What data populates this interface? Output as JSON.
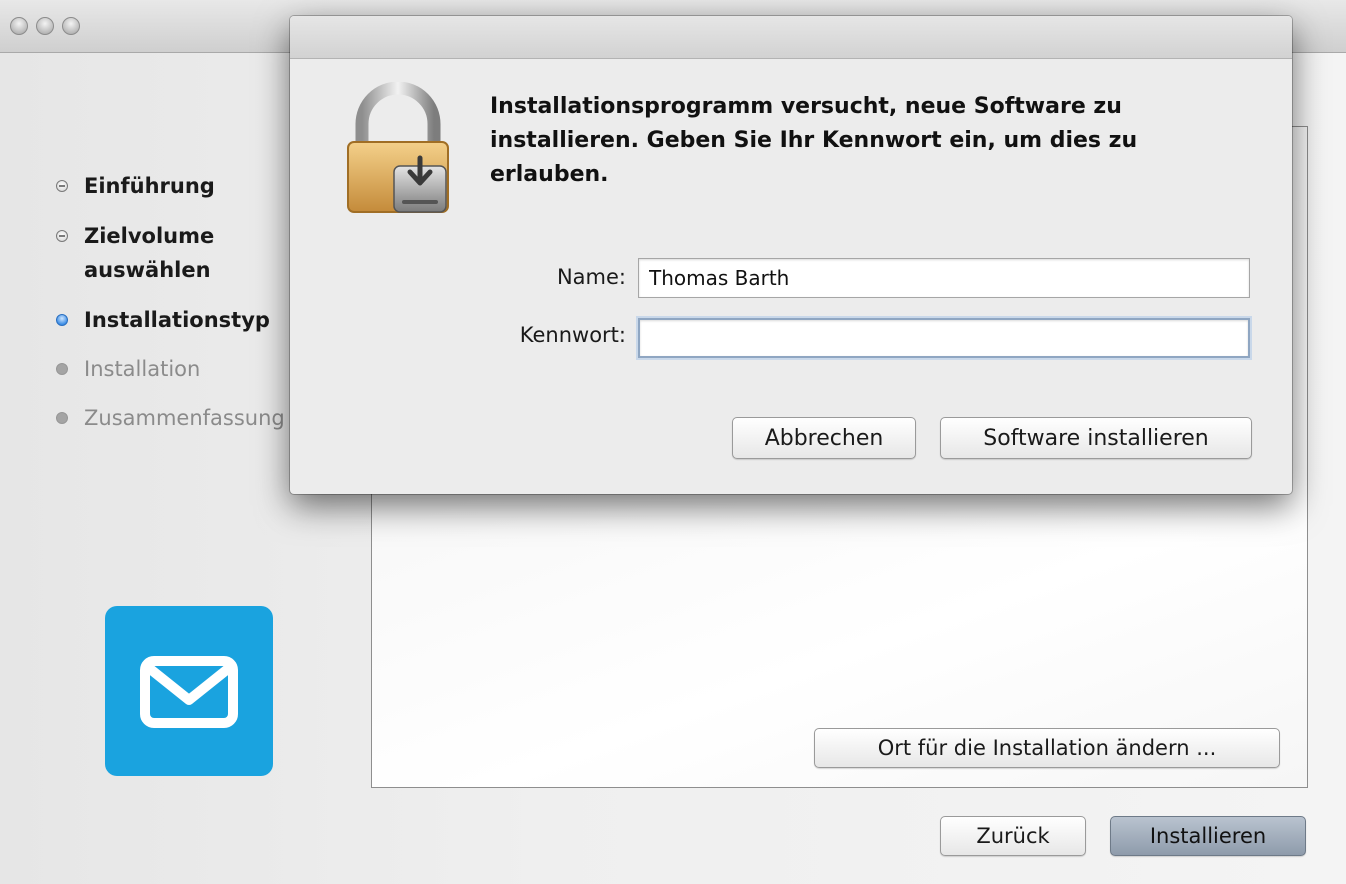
{
  "installer": {
    "steps": [
      {
        "label": "Einführung",
        "state": "done"
      },
      {
        "label": "Zielvolume auswählen",
        "state": "done"
      },
      {
        "label": "Installationstyp",
        "state": "current"
      },
      {
        "label": "Installation",
        "state": "future"
      },
      {
        "label": "Zusammenfassung",
        "state": "future"
      }
    ],
    "app_icon": "mail-envelope-icon",
    "change_location_label": "Ort für die Installation ändern ...",
    "back_label": "Zurück",
    "install_label": "Installieren",
    "colors": {
      "app_icon_bg": "#1aa3df",
      "current_step": "#3f8fe6"
    }
  },
  "dialog": {
    "icon": "lock-icon",
    "message": "Installationsprogramm versucht, neue Software zu installieren. Geben Sie Ihr Kennwort ein, um dies zu erlauben.",
    "name_label": "Name:",
    "name_value": "Thomas Barth",
    "password_label": "Kennwort:",
    "password_value": "",
    "cancel_label": "Abbrechen",
    "confirm_label": "Software installieren"
  }
}
